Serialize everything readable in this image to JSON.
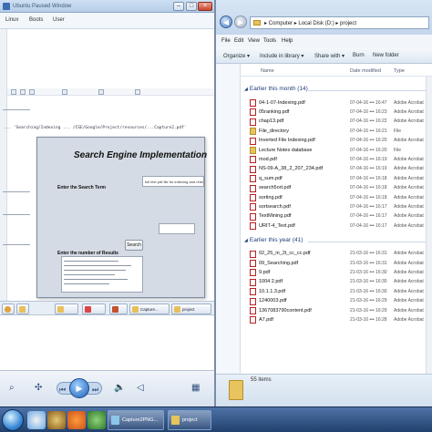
{
  "left_window": {
    "title": "Ubuntu Paused Window",
    "menu": [
      "Linux",
      "Boots",
      "User"
    ],
    "code_line": "... 'Searching/Indexing ... /CSE/Google/Project/resources/...Capture2.pdf'"
  },
  "dialog": {
    "title": "Search Engine Implementation",
    "term_label": "Enter the Search Term",
    "term_value": "full text pdf file for indexing and relevant",
    "num_label": "Enter the number of Results",
    "num_value": "",
    "search_button": "Search"
  },
  "left_tabs": [
    {
      "label": "",
      "icon": "chrome-icon"
    },
    {
      "label": "",
      "icon": "folder-icon"
    },
    {
      "label": "",
      "icon": "pdf-icon"
    },
    {
      "label": "",
      "icon": "ppt-icon"
    },
    {
      "label": "Capture...",
      "icon": "folder-icon"
    },
    {
      "label": "project",
      "icon": "folder-icon"
    }
  ],
  "explorer": {
    "breadcrumb": "▸ Computer ▸ Local Disk (D:) ▸ project",
    "menu": [
      "File",
      "Edit",
      "View",
      "Tools",
      "Help"
    ],
    "commands": [
      "Organize ▾",
      "Include in library ▾",
      "Share with ▾",
      "Burn",
      "New folder"
    ],
    "columns": [
      "Name",
      "Date modified",
      "Type"
    ],
    "groups": [
      {
        "label": "Earlier this month (14)",
        "rows": [
          {
            "name": "04-1-07-Indexing.pdf",
            "date": "07-04-16 ••• 16:47",
            "type": "Adobe Acrobat",
            "folder": false
          },
          {
            "name": "05ranking.pdf",
            "date": "07-04-16 ••• 16:23",
            "type": "Adobe Acrobat",
            "folder": false
          },
          {
            "name": "chap13.pdf",
            "date": "07-04-16 ••• 16:22",
            "type": "Adobe Acrobat",
            "folder": false
          },
          {
            "name": "File_directory",
            "date": "07-04-16 ••• 16:21",
            "type": "File",
            "folder": true
          },
          {
            "name": "Inverted File Indexing.pdf",
            "date": "07-04-16 ••• 16:20",
            "type": "Adobe Acrobat",
            "folder": false
          },
          {
            "name": "Lecture Notes database",
            "date": "07-04-16 ••• 16:20",
            "type": "File",
            "folder": true
          },
          {
            "name": "mod.pdf",
            "date": "07-04-16 ••• 16:19",
            "type": "Adobe Acrobat",
            "folder": false
          },
          {
            "name": "NS-09-A_38_2_207_234.pdf",
            "date": "07-04-16 ••• 16:19",
            "type": "Adobe Acrobat",
            "folder": false
          },
          {
            "name": "q_sum.pdf",
            "date": "07-04-16 ••• 16:18",
            "type": "Adobe Acrobat",
            "folder": false
          },
          {
            "name": "search5ort.pdf",
            "date": "07-04-16 ••• 16:18",
            "type": "Adobe Acrobat",
            "folder": false
          },
          {
            "name": "sorting.pdf",
            "date": "07-04-16 ••• 16:18",
            "type": "Adobe Acrobat",
            "folder": false
          },
          {
            "name": "sortsearch.pdf",
            "date": "07-04-16 ••• 16:17",
            "type": "Adobe Acrobat",
            "folder": false
          },
          {
            "name": "TextMining.pdf",
            "date": "07-04-16 ••• 16:17",
            "type": "Adobe Acrobat",
            "folder": false
          },
          {
            "name": "URIT-4_Text.pdf",
            "date": "07-04-16 ••• 16:17",
            "type": "Adobe Acrobat",
            "folder": false
          }
        ]
      },
      {
        "label": "Earlier this year (41)",
        "rows": [
          {
            "name": "02_25_in_2t_cc_cc.pdf",
            "date": "21-03-16 ••• 16:31",
            "type": "Adobe Acrobat",
            "folder": false
          },
          {
            "name": "09_Searching.pdf",
            "date": "21-03-16 ••• 16:31",
            "type": "Adobe Acrobat",
            "folder": false
          },
          {
            "name": "9.pdf",
            "date": "21-03-16 ••• 16:30",
            "type": "Adobe Acrobat",
            "folder": false
          },
          {
            "name": "1004 2.pdf",
            "date": "21-03-16 ••• 16:30",
            "type": "Adobe Acrobat",
            "folder": false
          },
          {
            "name": "10.1.1.3.pdf",
            "date": "21-03-16 ••• 16:30",
            "type": "Adobe Acrobat",
            "folder": false
          },
          {
            "name": "1240003.pdf",
            "date": "21-03-16 ••• 16:29",
            "type": "Adobe Acrobat",
            "folder": false
          },
          {
            "name": "1367083790content.pdf",
            "date": "21-03-16 ••• 16:29",
            "type": "Adobe Acrobat",
            "folder": false
          },
          {
            "name": "A7.pdf",
            "date": "21-03-16 ••• 16:28",
            "type": "Adobe Acrobat",
            "folder": false
          }
        ]
      }
    ],
    "status": "55 items"
  },
  "taskbar": {
    "tasks": [
      {
        "label": "Capture2PNG...",
        "icon": "paint-icon"
      },
      {
        "label": "project",
        "icon": "folder-icon"
      }
    ]
  },
  "colors": {
    "pdf_red": "#b82020",
    "folder_yellow": "#e7c35b",
    "group_blue": "#1e3d7a",
    "taskbar": "#2d4f82"
  }
}
